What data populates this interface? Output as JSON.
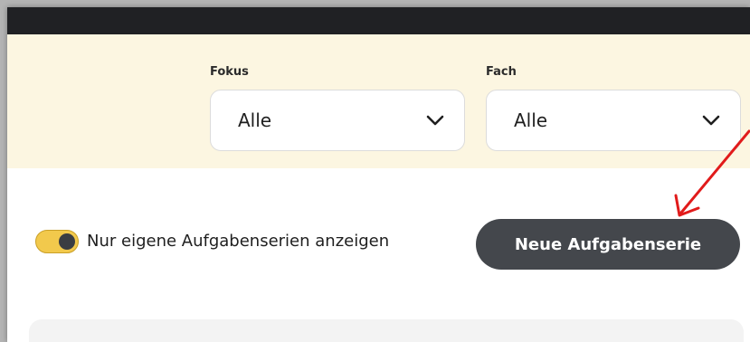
{
  "filters": {
    "fokus": {
      "label": "Fokus",
      "value": "Alle"
    },
    "fach": {
      "label": "Fach",
      "value": "Alle"
    }
  },
  "controls": {
    "toggle_label": "Nur eigene Aufgabenserien anzeigen",
    "toggle_on": true,
    "new_button_label": "Neue Aufgabenserie"
  },
  "annotation": {
    "arrow_color": "#e11b1b"
  },
  "colors": {
    "topbar": "#202124",
    "filterbar": "#fcf6e1",
    "toggle_track": "#f2c94c",
    "button": "#44474c"
  },
  "icons": [
    "chevron-down-icon",
    "chevron-down-icon"
  ]
}
